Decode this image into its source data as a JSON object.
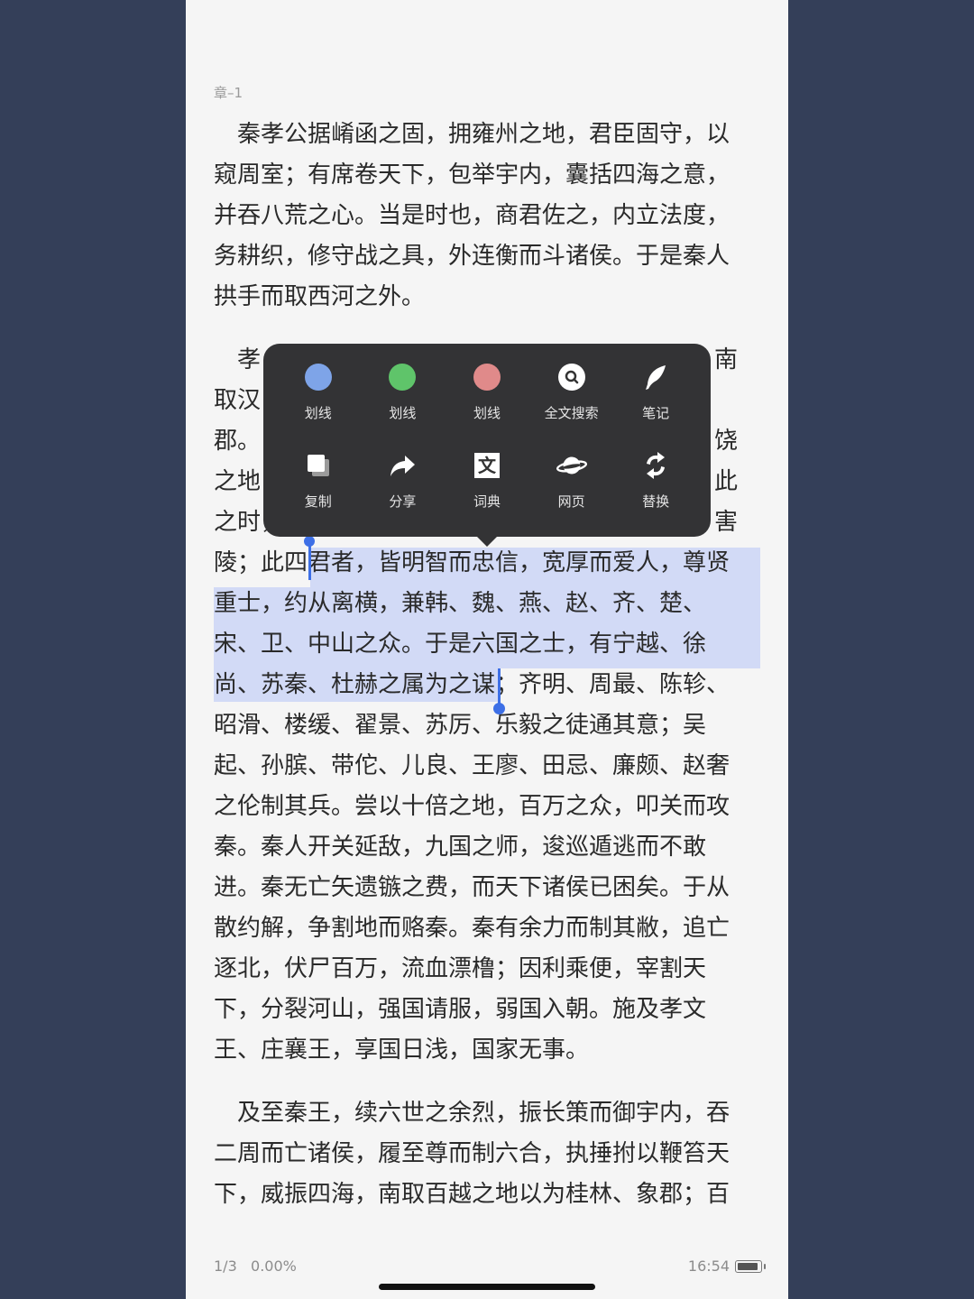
{
  "chapter": "章–1",
  "paragraphs": [
    [
      "　秦孝公据崤函之固，拥雍州之地，君臣固守，以",
      "窥周室；有席卷天下，包举宇内，囊括四海之意，",
      "并吞八荒之心。当是时也，商君佐之，内立法度，",
      "务耕织，修守战之具，外连衡而斗诸侯。于是秦人",
      "拱手而取西河之外。"
    ],
    [
      "　孝",
      "取汉",
      "郡。",
      "之地",
      "之时，"
    ]
  ],
  "right_edge": [
    "南",
    "",
    "饶",
    "此",
    "害"
  ],
  "lines_after": {
    "l1_pre": "陵；此四",
    "l1_sel": "君者，皆明智而忠信，宽厚而爱人，尊贤",
    "l2_sel": "重士，约从离横，兼韩、魏、燕、赵、齐、楚、",
    "l3_sel": "宋、卫、中山之众。于是六国之士，有宁越、徐",
    "l4_sel": "尚、苏秦、杜赫之属为之谋",
    "l4_post": "；齐明、周最、陈轸、",
    "rest": [
      "昭滑、楼缓、翟景、苏厉、乐毅之徒通其意；吴",
      "起、孙膑、带佗、儿良、王廖、田忌、廉颇、赵奢",
      "之伦制其兵。尝以十倍之地，百万之众，叩关而攻",
      "秦。秦人开关延敌，九国之师，逡巡遁逃而不敢",
      "进。秦无亡矢遗镞之费，而天下诸侯已困矣。于从",
      "散约解，争割地而赂秦。秦有余力而制其敝，追亡",
      "逐北，伏尸百万，流血漂橹；因利乘便，宰割天",
      "下，分裂河山，强国请服，弱国入朝。施及孝文",
      "王、庄襄王，享国日浅，国家无事。"
    ]
  },
  "paragraph3": [
    "　及至秦王，续六世之余烈，振长策而御宇内，吞",
    "二周而亡诸侯，履至尊而制六合，执捶拊以鞭笞天",
    "下，威振四海，南取百越之地以为桂林、象郡；百"
  ],
  "menu": {
    "row1": [
      {
        "label": "划线",
        "icon": "blue-dot-icon",
        "color": "#7ea4e8"
      },
      {
        "label": "划线",
        "icon": "green-dot-icon",
        "color": "#5fc46a"
      },
      {
        "label": "划线",
        "icon": "red-dot-icon",
        "color": "#e08a8a"
      },
      {
        "label": "全文搜索",
        "icon": "search-icon"
      },
      {
        "label": "笔记",
        "icon": "feather-icon"
      }
    ],
    "row2": [
      {
        "label": "复制",
        "icon": "copy-icon"
      },
      {
        "label": "分享",
        "icon": "share-icon"
      },
      {
        "label": "词典",
        "icon": "dictionary-icon",
        "glyph": "文"
      },
      {
        "label": "网页",
        "icon": "planet-icon"
      },
      {
        "label": "替换",
        "icon": "replace-icon"
      }
    ]
  },
  "footer": {
    "page": "1/3",
    "progress": "0.00%",
    "time": "16:54"
  }
}
